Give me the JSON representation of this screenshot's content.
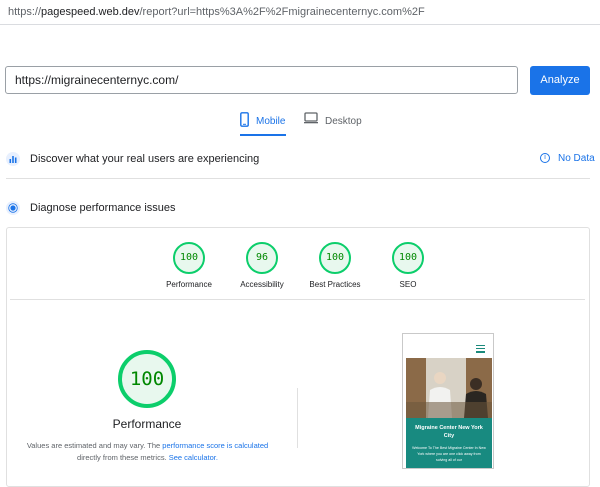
{
  "browser": {
    "url_scheme": "https://",
    "url_host": "pagespeed.web.dev",
    "url_path": "/report?url=https%3A%2F%2Fmigrainecenternyc.com%2F"
  },
  "search": {
    "value": "https://migrainecenternyc.com/",
    "analyze_label": "Analyze"
  },
  "tabs": {
    "mobile": "Mobile",
    "desktop": "Desktop"
  },
  "sections": {
    "real_users": "Discover what your real users are experiencing",
    "no_data": "No Data",
    "diagnose": "Diagnose performance issues"
  },
  "scores": [
    {
      "label": "Performance",
      "value": "100",
      "percent": 100
    },
    {
      "label": "Accessibility",
      "value": "96",
      "percent": 96
    },
    {
      "label": "Best Practices",
      "value": "100",
      "percent": 100
    },
    {
      "label": "SEO",
      "value": "100",
      "percent": 100
    }
  ],
  "main_score": {
    "value": "100",
    "label": "Performance",
    "note_prefix": "Values are estimated and may vary. The ",
    "note_link1": "performance score is calculated",
    "note_middle": " directly from these metrics. ",
    "note_link2": "See calculator."
  },
  "preview": {
    "heading": "Migraine Center New York City",
    "body": "Welcome To The Best Migraine Center In New York where you are one click away from solving all of our"
  },
  "colors": {
    "accent": "#1a73e8",
    "pass": "#0cce6b",
    "pass_text": "#008800",
    "teal": "#188a80"
  }
}
